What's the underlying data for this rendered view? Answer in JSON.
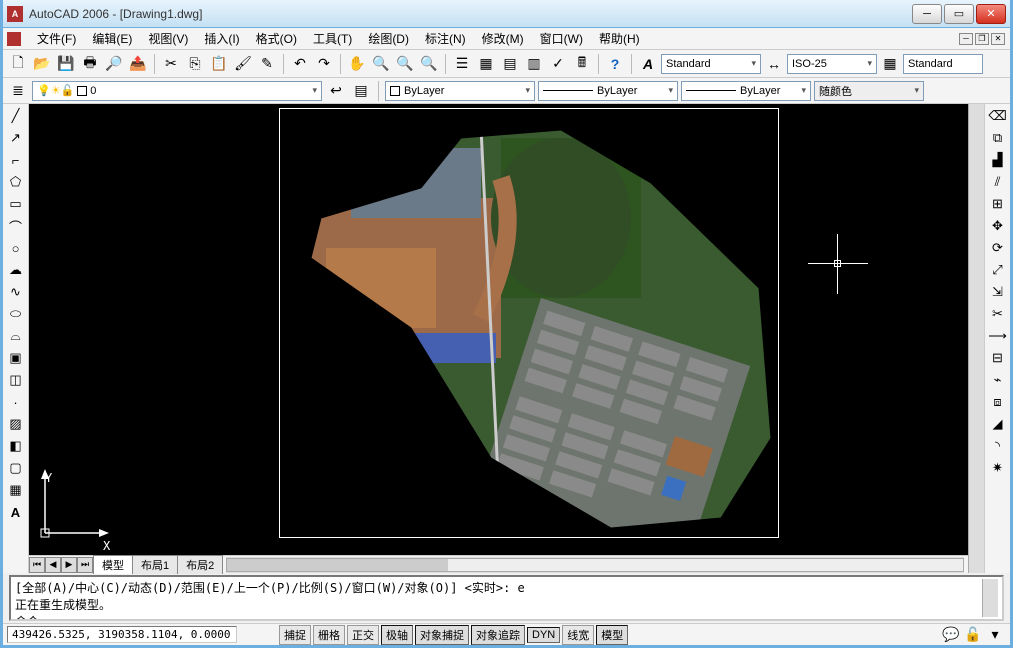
{
  "title": "AutoCAD 2006 - [Drawing1.dwg]",
  "menus": [
    "文件(F)",
    "编辑(E)",
    "视图(V)",
    "插入(I)",
    "格式(O)",
    "工具(T)",
    "绘图(D)",
    "标注(N)",
    "修改(M)",
    "窗口(W)",
    "帮助(H)"
  ],
  "text_style": "Standard",
  "dim_style": "ISO-25",
  "table_style": "Standard",
  "layer_value": "0",
  "color_value": "ByLayer",
  "linetype_value": "ByLayer",
  "lineweight_value": "ByLayer",
  "plotstyle_value": "随颜色",
  "tabs": {
    "model": "模型",
    "layout1": "布局1",
    "layout2": "布局2"
  },
  "ucs": {
    "x": "X",
    "y": "Y"
  },
  "cmd": {
    "line1": "[全部(A)/中心(C)/动态(D)/范围(E)/上一个(P)/比例(S)/窗口(W)/对象(O)] <实时>:  e",
    "line2": "正在重生成模型。",
    "prompt": "命令:"
  },
  "status": {
    "coords": "439426.5325, 3190358.1104, 0.0000",
    "snap": "捕捉",
    "grid": "栅格",
    "ortho": "正交",
    "polar": "极轴",
    "osnap": "对象捕捉",
    "otrack": "对象追踪",
    "dyn": "DYN",
    "lwt": "线宽",
    "model": "模型"
  },
  "left_tools_icons": [
    "line-icon",
    "xline-icon",
    "polyline-icon",
    "polygon-icon",
    "rectangle-icon",
    "arc-icon",
    "circle-icon",
    "revcloud-icon",
    "spline-icon",
    "ellipse-icon",
    "ellipse-arc-icon",
    "block-icon",
    "point-icon",
    "hatch-icon",
    "gradient-icon",
    "region-icon",
    "table-icon",
    "text-icon"
  ],
  "right_tools_icons": [
    "erase-icon",
    "copy-icon",
    "mirror-icon",
    "offset-icon",
    "array-icon",
    "move-icon",
    "rotate-icon",
    "scale-icon",
    "stretch-icon",
    "trim-icon",
    "extend-icon",
    "break-icon",
    "break2-icon",
    "join-icon",
    "chamfer-icon",
    "fillet-icon",
    "explode-icon"
  ]
}
